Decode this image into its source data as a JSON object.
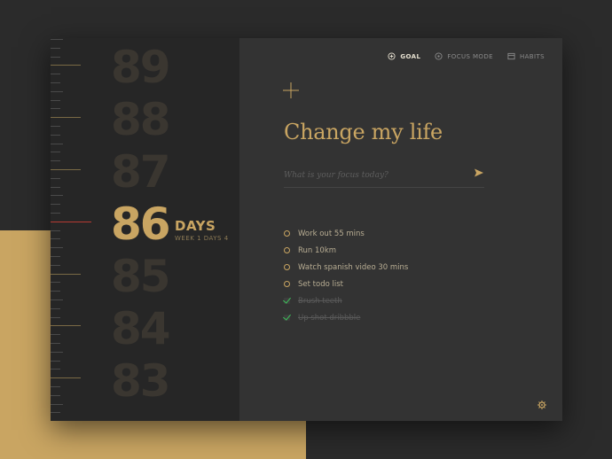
{
  "colors": {
    "accent": "#c9a562",
    "current_marker": "#b63a33",
    "done_check": "#3cc25a",
    "panel_left": "#262626",
    "panel_right": "#333333"
  },
  "countdown": {
    "numbers_above": [
      "89",
      "88",
      "87"
    ],
    "current": "86",
    "numbers_below": [
      "85",
      "84",
      "83"
    ],
    "unit_label": "DAYS",
    "week_label": "WEEK 1 DAYS 4"
  },
  "nav": {
    "items": [
      {
        "label": "GOAL",
        "icon": "goal-icon",
        "active": true
      },
      {
        "label": "FOCUS MODE",
        "icon": "focus-icon",
        "active": false
      },
      {
        "label": "HABITS",
        "icon": "habits-icon",
        "active": false
      }
    ]
  },
  "main": {
    "add_icon": "plus-icon",
    "title": "Change my life",
    "focus_placeholder": "What is your focus today?",
    "send_icon": "send-arrow-icon",
    "settings_icon": "gear-icon"
  },
  "todos": [
    {
      "text": "Work out 55 mins",
      "done": false
    },
    {
      "text": "Run 10km",
      "done": false
    },
    {
      "text": "Watch spanish video 30 mins",
      "done": false
    },
    {
      "text": "Set todo list",
      "done": false
    },
    {
      "text": "Brush teeth",
      "done": true
    },
    {
      "text": "Up shot dribbble",
      "done": true
    }
  ]
}
